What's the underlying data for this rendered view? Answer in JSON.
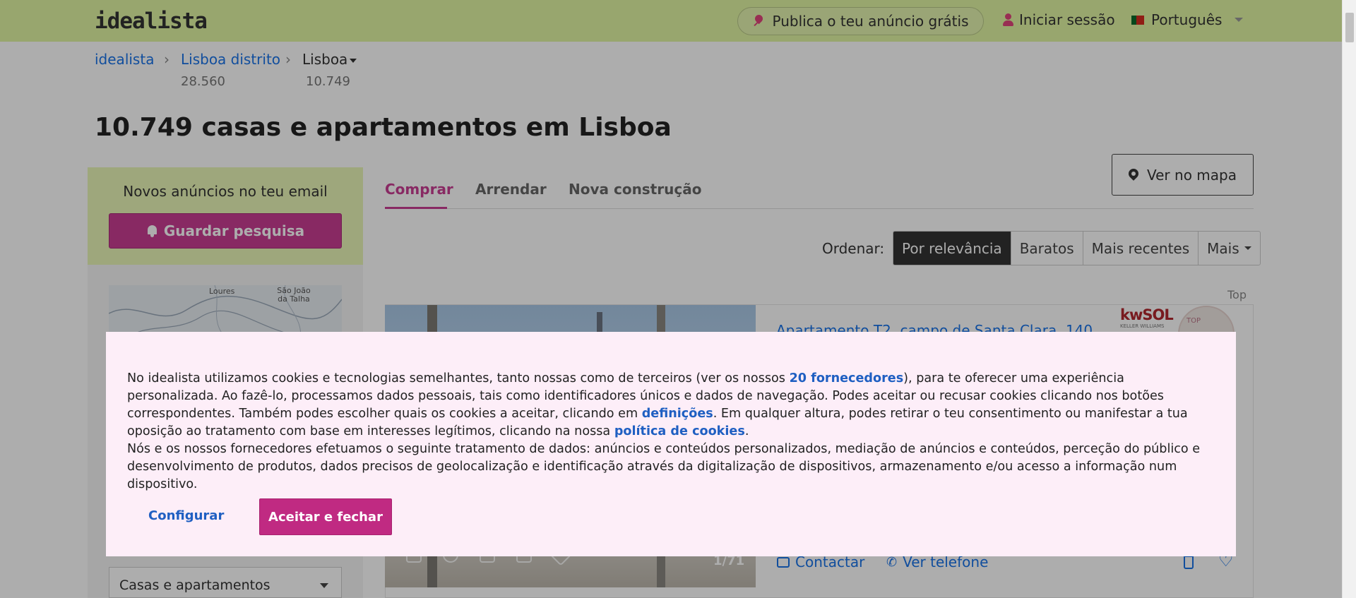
{
  "header": {
    "logo": "idealista",
    "publish_label": "Publica o teu anúncio grátis",
    "login_label": "Iniciar sessão",
    "language_label": "Português"
  },
  "breadcrumb": {
    "items": [
      {
        "label": "idealista",
        "count": ""
      },
      {
        "label": "Lisboa distrito",
        "count": "28.560"
      },
      {
        "label": "Lisboa",
        "count": "10.749"
      }
    ],
    "separator": "›"
  },
  "page_title": "10.749 casas e apartamentos em Lisboa",
  "sidebar": {
    "alert_title": "Novos anúncios no teu email",
    "save_search_label": "Guardar pesquisa",
    "map_labels": [
      "Loures",
      "São João da Talha"
    ],
    "property_type_value": "Casas e apartamentos"
  },
  "tabs": [
    "Comprar",
    "Arrendar",
    "Nova construção"
  ],
  "map_button_label": "Ver no mapa",
  "sort": {
    "label": "Ordenar:",
    "options": [
      "Por relevância",
      "Baratos",
      "Mais recentes",
      "Mais"
    ]
  },
  "listing": {
    "badge": "Top",
    "title": "Apartamento T2, campo de Santa Clara, 140",
    "agency": "kwSOL",
    "agency_sub": "KELLER WILLIAMS",
    "agent_badge": "TOP",
    "photo_count": "1/71",
    "contact_label": "Contactar",
    "phone_label": "Ver telefone"
  },
  "cookie": {
    "p1_a": "No idealista utilizamos cookies e tecnologias semelhantes, tanto nossas como de terceiros (ver os nossos ",
    "p1_link1": "20 fornecedores",
    "p1_b": "), para te oferecer uma experiência personalizada. Ao fazê-lo, processamos dados pessoais, tais como identificadores únicos e dados de navegação. Podes aceitar ou recusar cookies clicando nos botões correspondentes. Também podes escolher quais os cookies a aceitar, clicando em ",
    "p1_link2": "definições",
    "p1_c": ". Em qualquer altura, podes retirar o teu consentimento ou manifestar a tua oposição ao tratamento com base em interesses legítimos, clicando na nossa ",
    "p1_link3": "política de cookies",
    "p1_d": ".",
    "p2": "Nós e os nossos fornecedores efetuamos o seguinte tratamento de dados: anúncios e conteúdos personalizados, mediação de anúncios e conteúdos, perceção do público e desenvolvimento de produtos, dados precisos de geolocalização e identificação através da digitalização de dispositivos, armazenamento e/ou acesso a informação num dispositivo.",
    "configure_label": "Configurar",
    "accept_label": "Aceitar e fechar"
  },
  "colors": {
    "header_bg": "#e1f5a3",
    "brand_magenta": "#c93d93",
    "link_blue": "#1a73e8"
  }
}
